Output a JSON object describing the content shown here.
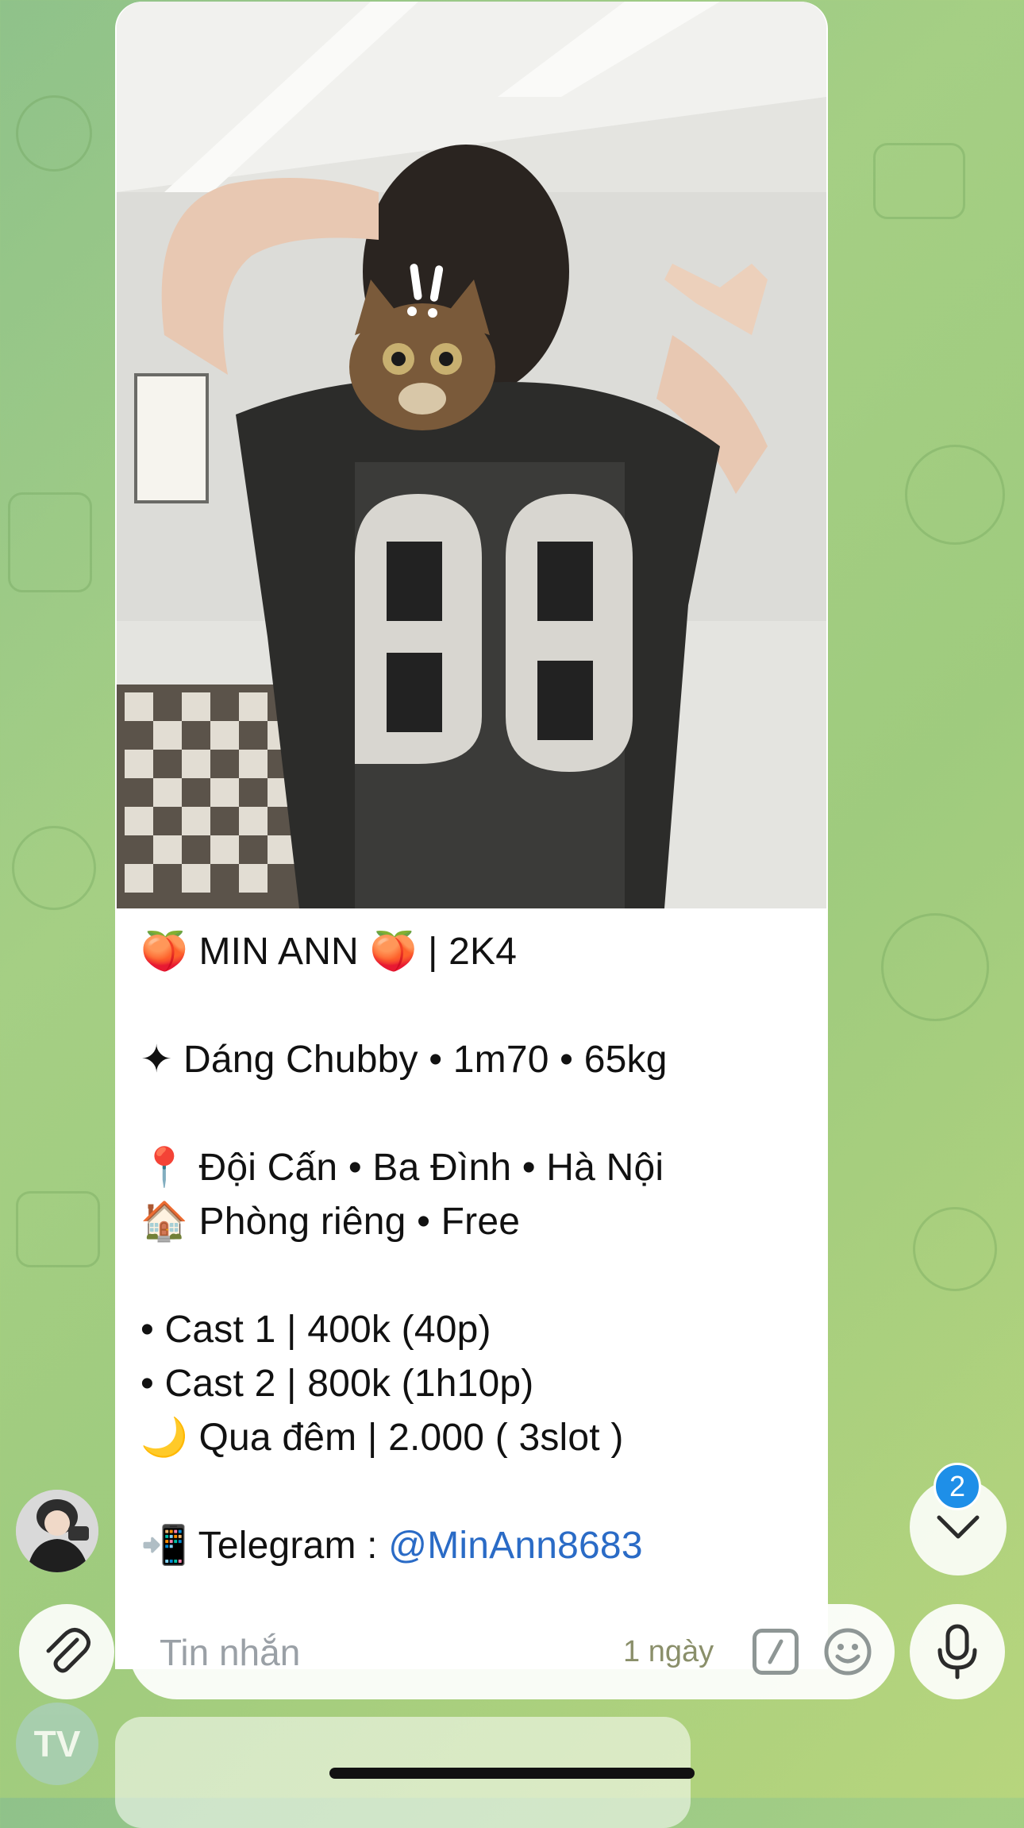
{
  "message": {
    "photo_alt": "photo",
    "caption": {
      "title": "🍑 MIN ANN 🍑 | 2K4",
      "body_type": "✦ Dáng Chubby • 1m70 • 65kg",
      "location": "📍 Đội Cấn • Ba Đình • Hà Nội",
      "room": "🏠 Phòng riêng • Free",
      "cast1": "• Cast 1 | 400k (40p)",
      "cast2": "• Cast 2 | 800k (1h10p)",
      "overnight": "🌙 Qua đêm | 2.000 ( 3slot )",
      "telegram_prefix": "📲 Telegram : ",
      "telegram_handle": "@MinAnn8683"
    }
  },
  "sender_avatar_bottom": {
    "initials": "TV"
  },
  "scroll_down": {
    "unread_count": "2"
  },
  "composer": {
    "placeholder": "Tin nhắn",
    "timer_label": "1 ngày"
  },
  "colors": {
    "link": "#2a6bc6",
    "badge": "#1e8fe8",
    "wallpaper": "#a5cf84"
  }
}
